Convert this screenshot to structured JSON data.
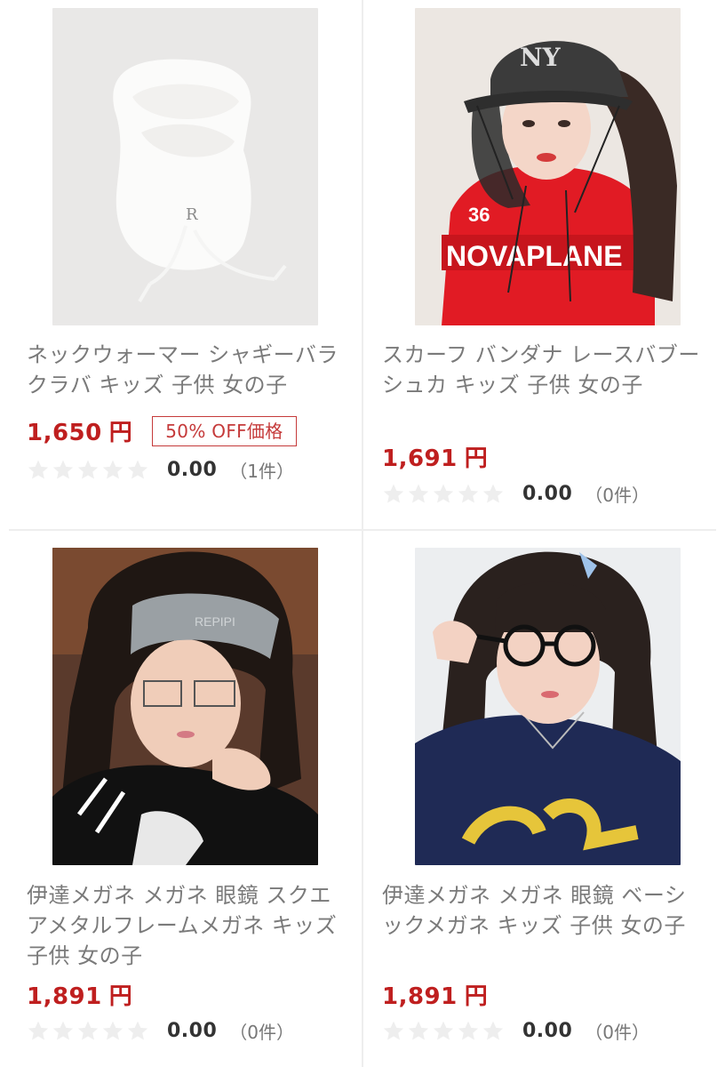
{
  "products": [
    {
      "name": "ネックウォーマー シャギーバラクラバ キッズ 子供 女の子",
      "price": "1,650",
      "currency": "円",
      "badge": "50% OFF価格",
      "rating": "0.00",
      "review_count": "（1件）",
      "image": "white-shaggy-balaclava-photo"
    },
    {
      "name": "スカーフ バンダナ レースバブーシュカ キッズ 子供 女の子",
      "price": "1,691",
      "currency": "円",
      "rating": "0.00",
      "review_count": "（0件）",
      "image": "model-lace-bandana-cap-photo"
    },
    {
      "name": "伊達メガネ メガネ 眼鏡 スクエアメタルフレームメガネ キッズ 子供 女の子",
      "price": "1,891",
      "currency": "円",
      "rating": "0.00",
      "review_count": "（0件）",
      "image": "model-square-metal-glasses-photo"
    },
    {
      "name": "伊達メガネ メガネ 眼鏡 ベーシックメガネ キッズ 子供 女の子",
      "price": "1,891",
      "currency": "円",
      "rating": "0.00",
      "review_count": "（0件）",
      "image": "model-basic-black-glasses-photo"
    }
  ],
  "colors": {
    "price": "#bf1f1f",
    "badge": "#c53a3a",
    "text": "#7a7a7a",
    "star_empty": "#eeeeee"
  }
}
